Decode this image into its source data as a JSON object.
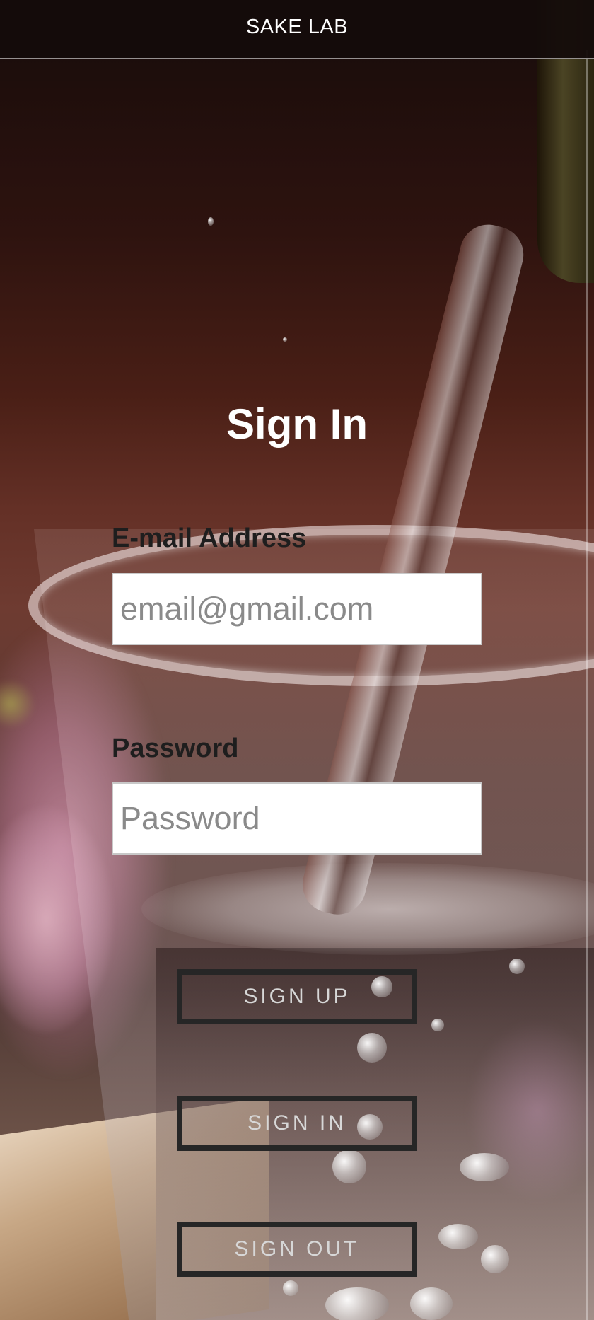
{
  "header": {
    "brand": "SAKE LAB"
  },
  "form": {
    "title": "Sign In",
    "email": {
      "label": "E-mail Address",
      "placeholder": "email@gmail.com",
      "value": ""
    },
    "password": {
      "label": "Password",
      "placeholder": "Password",
      "value": ""
    }
  },
  "buttons": {
    "sign_up": "SIGN UP",
    "sign_in": "SIGN IN",
    "sign_out": "SIGN OUT"
  },
  "background": {
    "image": "sake-pouring-into-glass-photo"
  },
  "colors": {
    "header_bg": "#140c0b",
    "title": "#ffffff",
    "label": "#1e1e1e",
    "button_border": "#262626",
    "button_text": "#d7d7d7"
  }
}
